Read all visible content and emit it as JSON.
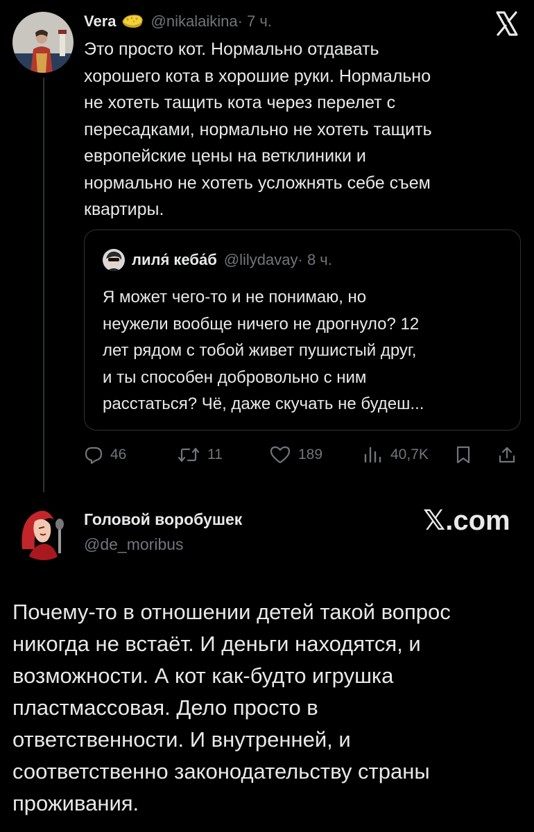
{
  "tweet": {
    "display_name": "Vera",
    "badge_icon": "soap-sponge-emoji",
    "handle": "@nikalaikina",
    "time": " · 7 ч.",
    "text": "Это просто кот. Нормально отдавать\nхорошего кота в хорошие руки. Нормально\nне хотеть тащить кота через перелет с\nпересадками, нормально не хотеть тащить\nевропейские цены на ветклиники и\nнормально не хотеть усложнять себе съем\nквартиры.",
    "quote": {
      "display_name": "лиля́ кеба́б",
      "handle": "@lilydavay",
      "time": " · 8 ч.",
      "text": "Я может чего-то и не понимаю, но\nнеужели вообще ничего не дрогнуло? 12\nлет рядом с тобой живет пушистый друг,\nи ты способен добровольно с ним\nрасстаться? Чё, даже скучать не будеш..."
    },
    "stats": {
      "replies": "46",
      "retweets": "11",
      "likes": "189",
      "views": "40,7K"
    }
  },
  "reply": {
    "display_name": "Головой воробушек",
    "handle": "@de_moribus",
    "brand": "𝕏.com",
    "text": "Почему-то в отношении детей такой вопрос\nникогда не встаёт. И деньги находятся, и\nвозможности. А кот как-будто игрушка\nпластмассовая. Дело просто в\nответственности. И внутренней, и\nсоответственно законодательству страны\nпроживания."
  },
  "colors": {
    "background": "#000000",
    "text": "#e7e9ea",
    "muted": "#71767b",
    "border": "#2f3336"
  }
}
